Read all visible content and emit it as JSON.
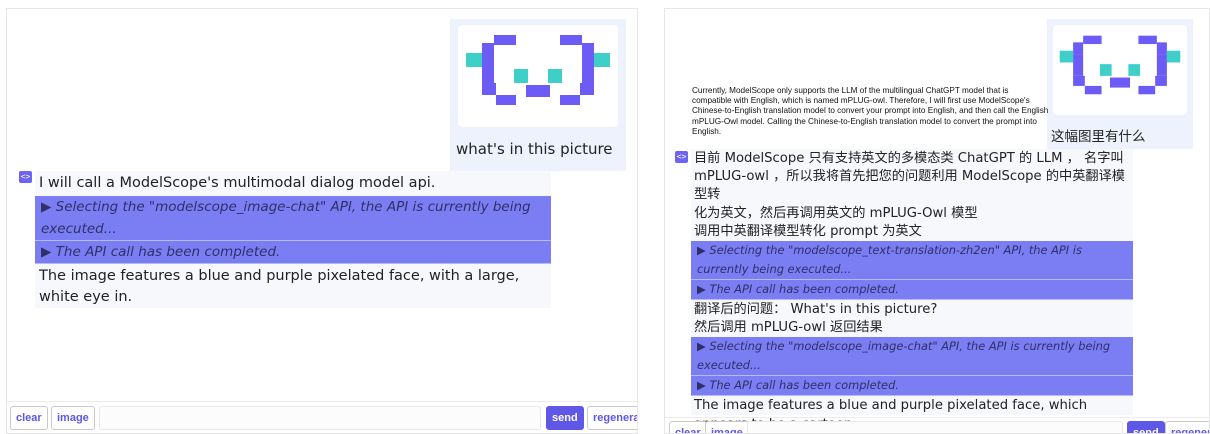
{
  "left": {
    "user_message": "what's in this picture",
    "bot": {
      "intro": "I will call a ModelScope's multimodal dialog model api.",
      "api_rows": [
        "▶ Selecting the \"modelscope_image-chat\" API, the API is currently being executed...",
        "▶ The API call has been completed."
      ],
      "answer": "The image features a blue and purple pixelated face, with a large, white eye in."
    },
    "toolbar": {
      "clear": "clear",
      "image": "image",
      "send": "send",
      "regenerate": "regenerate"
    }
  },
  "right": {
    "image_description": "Currently, ModelScope only supports the LLM of the multilingual ChatGPT model that is compatible with English, which is named mPLUG-owl. Therefore, I will first use ModelScope's Chinese-to-English translation model to convert your prompt into English, and then call the English mPLUG-Owl model. Calling  the Chinese-to-English translation model to convert the prompt into English.",
    "user_message": "这幅图里有什么",
    "bot": {
      "intro_lines": [
        "目前 ModelScope 只有支持英文的多模态类 ChatGPT 的 LLM ， 名字叫",
        "mPLUG-owl ，所以我将首先把您的问题利用 ModelScope 的中英翻译模型转",
        "化为英文，然后再调用英文的 mPLUG-Owl 模型",
        "调用中英翻译模型转化 prompt 为英文"
      ],
      "translation_rows": [
        "▶ Selecting the \"modelscope_text-translation-zh2en\" API, the API is currently being executed...",
        "▶ The API call has been completed."
      ],
      "translated_question": "翻译后的问题： What's in this picture?",
      "then_call": "然后调用 mPLUG-owl 返回结果",
      "image_chat_rows": [
        "▶ Selecting the \"modelscope_image-chat\" API, the API is currently being executed...",
        "▶ The API call has been completed."
      ],
      "answer": "The image features a blue and purple pixelated face, which appears to be a cartoon."
    },
    "toolbar": {
      "clear": "clear",
      "image": "image",
      "send": "send",
      "regenerate": "regenerate"
    }
  },
  "colors": {
    "accent": "#5f57e8",
    "api_row": "#7b7ef2",
    "teal": "#3fcfc9",
    "purple": "#6c5cf5",
    "user_bubble": "#eef2fd"
  },
  "icons": {
    "bot_avatar": "bot-avatar-icon",
    "pixel_face": "pixel-face-image"
  }
}
